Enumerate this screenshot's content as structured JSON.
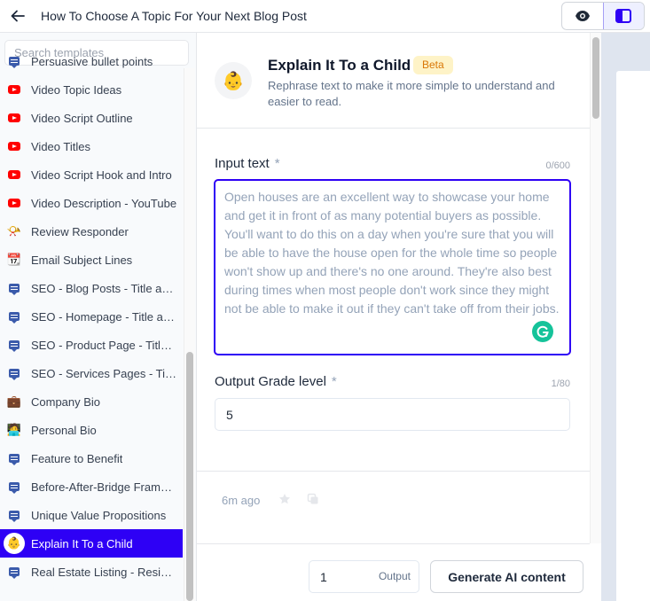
{
  "topbar": {
    "title": "How To Choose A Topic For Your Next Blog Post",
    "back_icon": "arrow-left-icon",
    "view_toggle": [
      {
        "name": "preview",
        "icon": "eye-icon",
        "active": false
      },
      {
        "name": "sidebar-layout",
        "icon": "layout-sidebar-icon",
        "active": true
      }
    ]
  },
  "sidebar": {
    "search_placeholder": "Search templates",
    "items": [
      {
        "label": "Persuasive bullet points",
        "icon": "message-icon"
      },
      {
        "label": "Video Topic Ideas",
        "icon": "youtube-icon"
      },
      {
        "label": "Video Script Outline",
        "icon": "youtube-icon"
      },
      {
        "label": "Video Titles",
        "icon": "youtube-icon"
      },
      {
        "label": "Video Script Hook and Intro",
        "icon": "youtube-icon"
      },
      {
        "label": "Video Description - YouTube",
        "icon": "youtube-icon"
      },
      {
        "label": "Review Responder",
        "icon": "megaphone-icon"
      },
      {
        "label": "Email Subject Lines",
        "icon": "envelope-icon"
      },
      {
        "label": "SEO - Blog Posts - Title and Meta Descriptions",
        "icon": "message-icon"
      },
      {
        "label": "SEO - Homepage - Title and Meta Descriptions",
        "icon": "message-icon"
      },
      {
        "label": "SEO - Product Page - Title and Meta Descriptions",
        "icon": "message-icon"
      },
      {
        "label": "SEO - Services Pages - Title and Meta Descriptions",
        "icon": "message-icon"
      },
      {
        "label": "Company Bio",
        "icon": "briefcase-icon"
      },
      {
        "label": "Personal Bio",
        "icon": "person-laptop-icon"
      },
      {
        "label": "Feature to Benefit",
        "icon": "message-icon"
      },
      {
        "label": "Before-After-Bridge Framework",
        "icon": "message-icon"
      },
      {
        "label": "Unique Value Propositions",
        "icon": "message-icon"
      },
      {
        "label": "Explain It To a Child",
        "icon": "baby-icon",
        "active": true
      },
      {
        "label": "Real Estate Listing - Residential",
        "icon": "message-icon"
      }
    ]
  },
  "template": {
    "title": "Explain It To a Child",
    "badge": "Beta",
    "description": "Rephrase text to make it more simple to understand and easier to read.",
    "icon": "baby-icon"
  },
  "form": {
    "input_text": {
      "label": "Input text",
      "required_mark": "*",
      "counter": "0/600",
      "placeholder": "Open houses are an excellent way to showcase your home and get it in front of as many potential buyers as possible. You'll want to do this on a day when you're sure that you will be able to have the house open for the whole time so people won't show up and there's no one around. They're also best during times when most people don't work since they might not be able to make it out if they can't take off from their jobs.",
      "value": ""
    },
    "grade_level": {
      "label": "Output Grade level",
      "required_mark": "*",
      "counter": "1/80",
      "value": "5"
    }
  },
  "history": {
    "time": "6m ago"
  },
  "footer": {
    "output_count": "1",
    "output_suffix": "Output",
    "generate_label": "Generate AI content"
  },
  "colors": {
    "accent": "#2e00f5",
    "beta_bg": "#fef3c7",
    "beta_text": "#d97706",
    "grammarly": "#15c39a"
  }
}
